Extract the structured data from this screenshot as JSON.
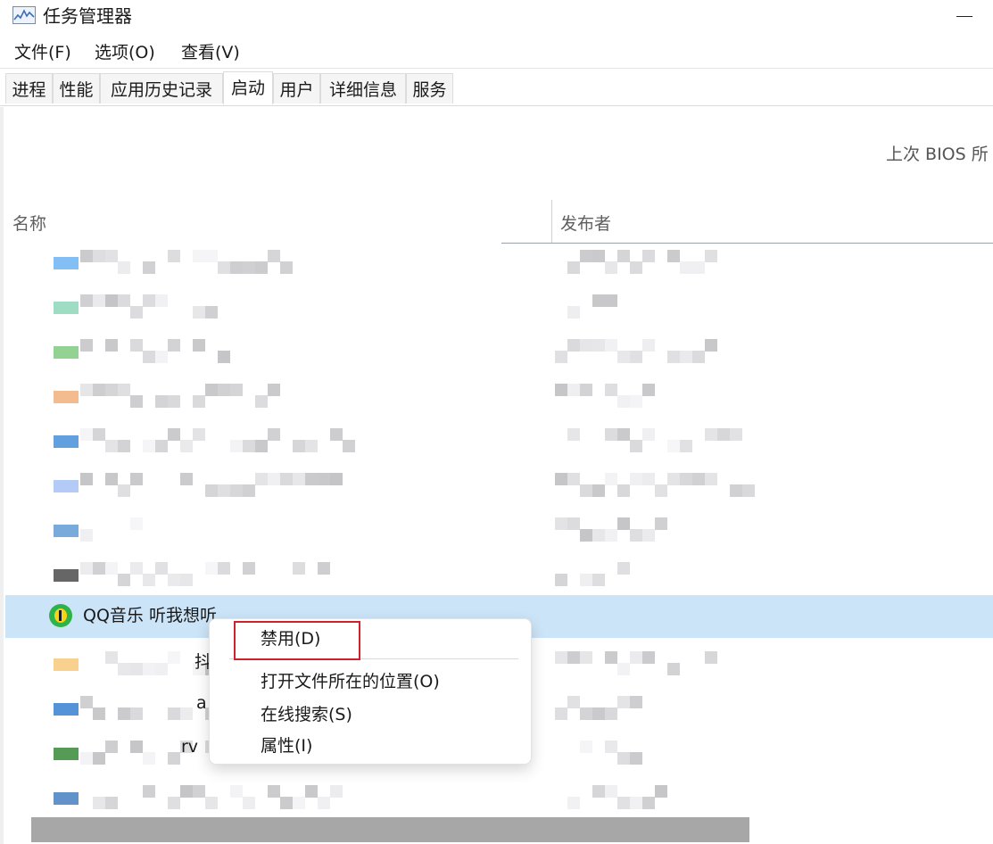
{
  "window": {
    "title": "任务管理器"
  },
  "menu": [
    "文件(F)",
    "选项(O)",
    "查看(V)"
  ],
  "tabs": [
    {
      "label": "进程"
    },
    {
      "label": "性能"
    },
    {
      "label": "应用历史记录"
    },
    {
      "label": "启动",
      "active": true
    },
    {
      "label": "用户"
    },
    {
      "label": "详细信息"
    },
    {
      "label": "服务"
    }
  ],
  "bios_text": "上次 BIOS 所",
  "columns": {
    "name": "名称",
    "publisher": "发布者"
  },
  "selected_row": {
    "name": "QQ音乐 听我想听"
  },
  "partial_texts": {
    "row10": "抖",
    "row11": "a",
    "row12": "rv"
  },
  "context_menu": {
    "items": [
      "禁用(D)",
      "打开文件所在的位置(O)",
      "在线搜索(S)",
      "属性(I)"
    ],
    "highlighted": "禁用(D)"
  },
  "colors": {
    "selection": "#cce4f7",
    "highlight_border": "#d0202a"
  }
}
